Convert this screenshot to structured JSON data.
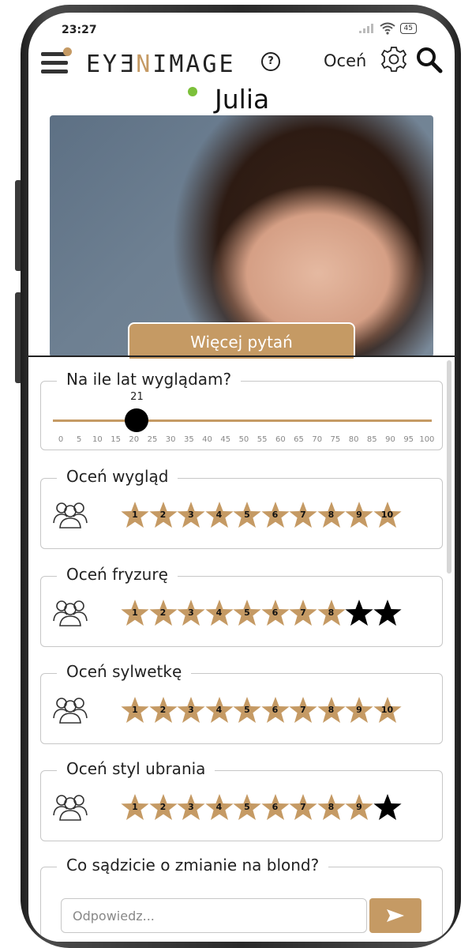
{
  "status_bar": {
    "time": "23:27",
    "battery": "45"
  },
  "app_bar": {
    "logo_prefix": "EY",
    "logo_mid1": "Ǝ",
    "logo_mid2": "N",
    "logo_mid3": "I",
    "logo_suffix": "MAGE",
    "help_glyph": "?",
    "rate_link": "Oceń"
  },
  "profile": {
    "name": "Julia",
    "online": true
  },
  "more_questions_button": "Więcej pytań",
  "age_question": {
    "title": "Na ile lat wyglądam?",
    "value": "21",
    "value_fraction": 0.21,
    "ticks": [
      "0",
      "5",
      "10",
      "15",
      "20",
      "25",
      "30",
      "35",
      "40",
      "45",
      "50",
      "55",
      "60",
      "65",
      "70",
      "75",
      "80",
      "85",
      "90",
      "95",
      "100"
    ]
  },
  "ratings": [
    {
      "title": "Oceń wygląd",
      "labels": [
        "1",
        "2",
        "3",
        "4",
        "5",
        "6",
        "7",
        "8",
        "9",
        "10"
      ],
      "filled": 10
    },
    {
      "title": "Oceń fryzurę",
      "labels": [
        "1",
        "2",
        "3",
        "4",
        "5",
        "6",
        "7",
        "8",
        "",
        ""
      ],
      "filled": 8
    },
    {
      "title": "Oceń sylwetkę",
      "labels": [
        "1",
        "2",
        "3",
        "4",
        "5",
        "6",
        "7",
        "8",
        "9",
        "10"
      ],
      "filled": 10
    },
    {
      "title": "Oceń styl ubrania",
      "labels": [
        "1",
        "2",
        "3",
        "4",
        "5",
        "6",
        "7",
        "8",
        "9",
        ""
      ],
      "filled": 9
    }
  ],
  "open_question": {
    "title": "Co sądzicie o zmianie na blond?",
    "placeholder": "Odpowiedz..."
  },
  "colors": {
    "accent": "#c59a64",
    "online": "#7cc03a",
    "star_empty": "#000000"
  }
}
